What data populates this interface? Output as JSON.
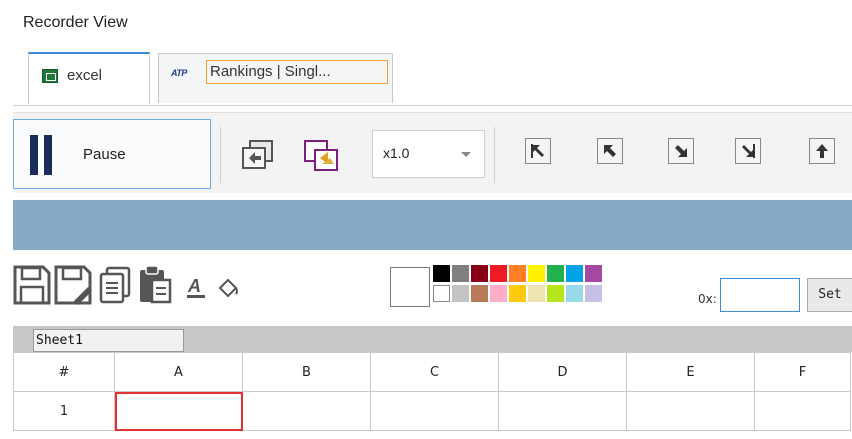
{
  "window": {
    "title": "Recorder View"
  },
  "tabs": [
    {
      "label": "excel",
      "icon": "excel-icon",
      "active": true
    },
    {
      "label": "Rankings | Singl...",
      "icon": "atp-icon",
      "icon_text": "ATP",
      "active": false
    }
  ],
  "toolbar": {
    "pause_label": "Pause",
    "speed_value": "x1.0",
    "icons": [
      "restore-icon",
      "snapshot-icon",
      "move-top-left-icon",
      "move-up-left-icon",
      "move-down-right-icon",
      "move-bottom-right-icon",
      "move-up-icon"
    ]
  },
  "format_tools": {
    "icons": [
      "save-icon",
      "save-as-icon",
      "copy-icon",
      "paste-icon",
      "font-color-icon",
      "fill-color-icon"
    ],
    "font_icon_text": "A",
    "palette_row1": [
      "#000000",
      "#7f7f7f",
      "#880015",
      "#ed1c24",
      "#ff7f27",
      "#fff200",
      "#22b14c",
      "#00a2e8",
      "#a349a4"
    ],
    "palette_row2": [
      "#ffffff",
      "#c3c3c3",
      "#b97a57",
      "#ffaec9",
      "#ffc90e",
      "#efe4b0",
      "#b5e61d",
      "#99d9ea",
      "#c8bfe7"
    ],
    "hex_label": "0x:",
    "hex_value": "",
    "set_label": "Set"
  },
  "sheet": {
    "tab_label": "Sheet1",
    "corner_label": "#",
    "columns": [
      "A",
      "B",
      "C",
      "D",
      "E",
      "F"
    ],
    "rows": [
      {
        "label": "1",
        "cells": [
          "",
          "",
          "",
          "",
          "",
          ""
        ]
      }
    ],
    "selected_cell": "A1"
  }
}
